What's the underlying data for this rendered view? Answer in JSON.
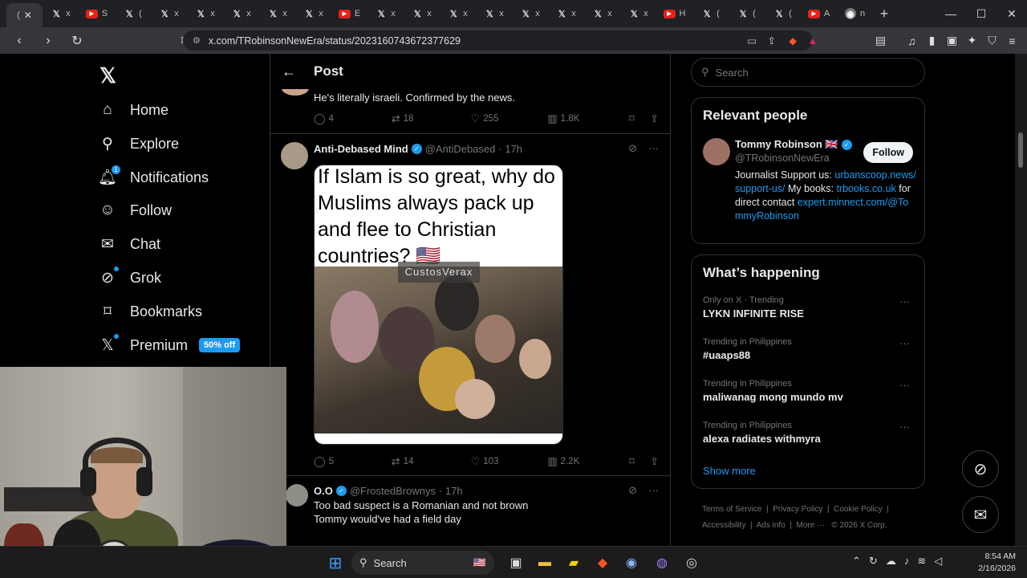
{
  "browser": {
    "tabs": [
      {
        "icon": "x-icon",
        "label": "( ",
        "active": true
      },
      {
        "icon": "x-icon",
        "label": "x"
      },
      {
        "icon": "youtube-icon",
        "label": "S"
      },
      {
        "icon": "x-icon",
        "label": "("
      },
      {
        "icon": "x-icon",
        "label": "x"
      },
      {
        "icon": "x-icon",
        "label": "x"
      },
      {
        "icon": "x-icon",
        "label": "x"
      },
      {
        "icon": "x-icon",
        "label": "x"
      },
      {
        "icon": "x-icon",
        "label": "x"
      },
      {
        "icon": "youtube-icon",
        "label": "E"
      },
      {
        "icon": "x-icon",
        "label": "x"
      },
      {
        "icon": "x-icon",
        "label": "x"
      },
      {
        "icon": "x-icon",
        "label": "x"
      },
      {
        "icon": "x-icon",
        "label": "x"
      },
      {
        "icon": "x-icon",
        "label": "x"
      },
      {
        "icon": "x-icon",
        "label": "x"
      },
      {
        "icon": "x-icon",
        "label": "x"
      },
      {
        "icon": "x-icon",
        "label": "x"
      },
      {
        "icon": "youtube-icon",
        "label": "H"
      },
      {
        "icon": "x-icon",
        "label": "("
      },
      {
        "icon": "x-icon",
        "label": "("
      },
      {
        "icon": "x-icon",
        "label": "("
      },
      {
        "icon": "youtube-icon",
        "label": "A"
      },
      {
        "icon": "chat-icon",
        "label": "n"
      }
    ],
    "url": "x.com/TRobinsonNewEra/status/2023160743672377629"
  },
  "nav": {
    "home": "Home",
    "explore": "Explore",
    "notifications": "Notifications",
    "notifications_badge": "1",
    "follow": "Follow",
    "chat": "Chat",
    "grok": "Grok",
    "bookmarks": "Bookmarks",
    "premium": "Premium",
    "premium_badge": "50% off"
  },
  "post_header": {
    "title": "Post"
  },
  "posts": [
    {
      "text": "He's literally israeli. Confirmed by the news.",
      "replies": "4",
      "reposts": "18",
      "likes": "255",
      "views": "1.8K"
    },
    {
      "name": "Anti-Debased Mind",
      "handle": "@AntiDebased",
      "time": "· 17h",
      "meme_text": "If Islam is so great, why do Muslims always pack up and flee to Christian countries? 🇺🇸",
      "watermark": "CustosVerax",
      "replies": "5",
      "reposts": "14",
      "likes": "103",
      "views": "2.2K"
    },
    {
      "name": "O.O",
      "handle": "@FrostedBrownys",
      "time": "· 17h",
      "text": "Too bad suspect is a Romanian and not brown Tommy would've had a field day"
    }
  ],
  "sidebar": {
    "search_placeholder": "Search",
    "relevant_title": "Relevant people",
    "person": {
      "name": "Tommy Robinson 🇬🇧",
      "handle": "@TRobinsonNewEra",
      "follow_label": "Follow",
      "bio_1": "Journalist Support us:",
      "bio_link_1": "urbanscoop.news/support-us/",
      "bio_2": " My books: ",
      "bio_link_2": "trbooks.co.uk",
      "bio_3": " for direct contact ",
      "bio_link_3": "expert.minnect.com/@TommyRobinson"
    },
    "happening_title": "What’s happening",
    "trends": [
      {
        "category": "Only on X · Trending",
        "name": "LYKN INFINITE RISE"
      },
      {
        "category": "Trending in Philippines",
        "name": "#uaaps88"
      },
      {
        "category": "Trending in Philippines",
        "name": "maliwanag mong mundo mv"
      },
      {
        "category": "Trending in Philippines",
        "name": "alexa radiates withmyra"
      }
    ],
    "show_more": "Show more",
    "footer": [
      "Terms of Service",
      "Privacy Policy",
      "Cookie Policy",
      "Accessibility",
      "Ads info",
      "More ···",
      "© 2026 X Corp."
    ]
  },
  "taskbar": {
    "search": "Search",
    "time": "8:54 AM",
    "date": "2/16/2026"
  },
  "colors": {
    "accent": "#1d9bf0",
    "background": "#000000",
    "muted": "#71767b"
  }
}
